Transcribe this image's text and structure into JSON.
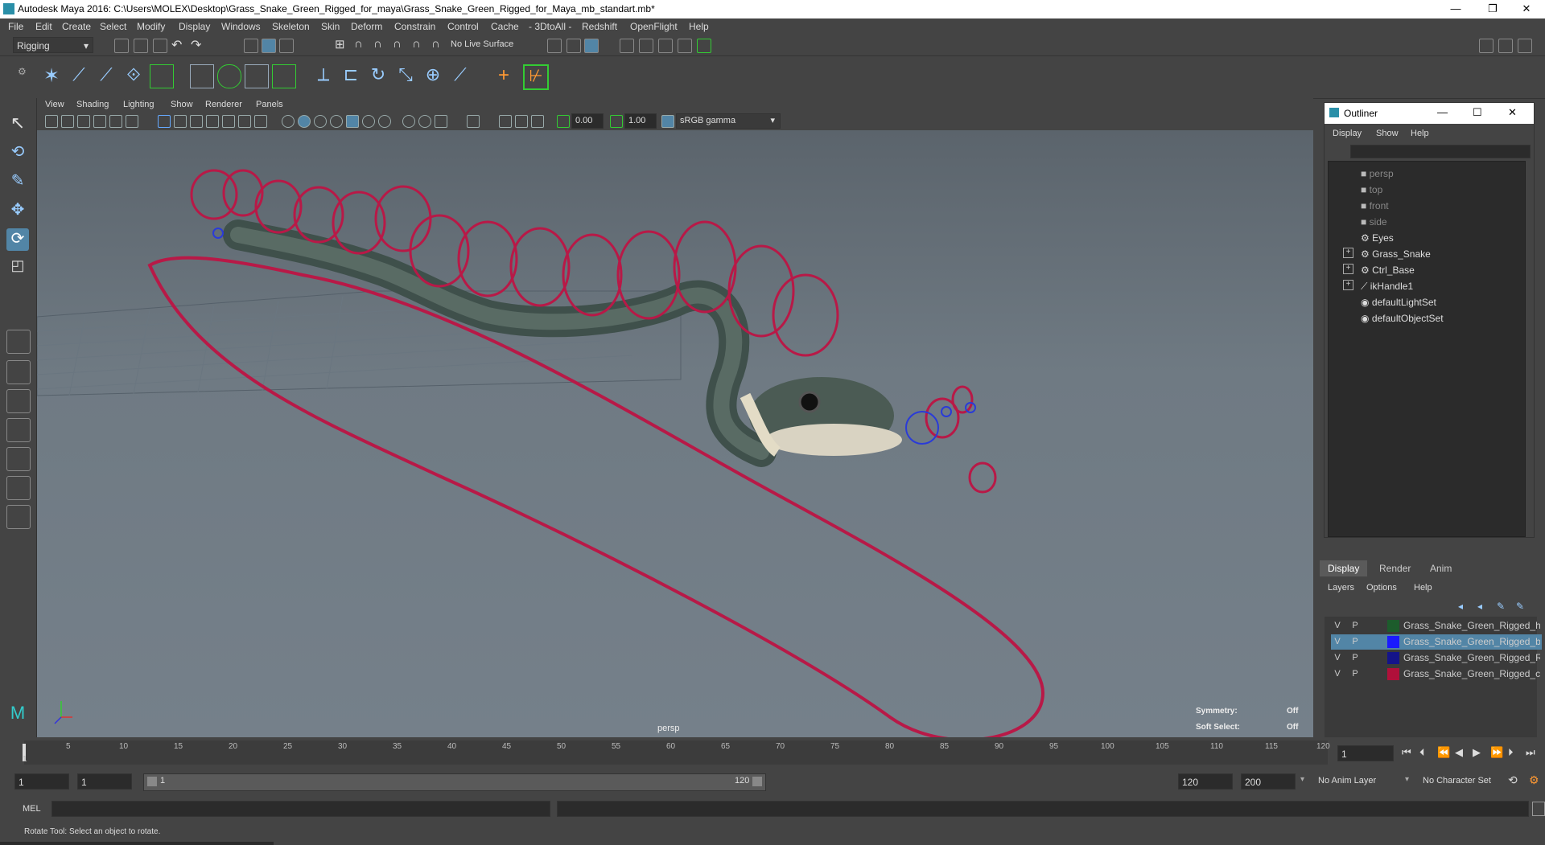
{
  "app": {
    "title": "Autodesk Maya 2016: C:\\Users\\MOLEX\\Desktop\\Grass_Snake_Green_Rigged_for_maya\\Grass_Snake_Green_Rigged_for_Maya_mb_standart.mb*",
    "window_controls": [
      "—",
      "❐",
      "✕"
    ]
  },
  "menubar": [
    "File",
    "Edit",
    "Create",
    "Select",
    "Modify",
    "Display",
    "Windows",
    "Skeleton",
    "Skin",
    "Deform",
    "Constrain",
    "Control",
    "Cache",
    "- 3DtoAll -",
    "Redshift",
    "OpenFlight",
    "Help"
  ],
  "statusline": {
    "menuset": "Rigging",
    "live_surface": "No Live Surface"
  },
  "viewport": {
    "menus": [
      "View",
      "Shading",
      "Lighting",
      "Show",
      "Renderer",
      "Panels"
    ],
    "near_value": "0.00",
    "far_value": "1.00",
    "colorspace": "sRGB gamma",
    "camera_label": "persp",
    "hud": {
      "symmetry_label": "Symmetry:",
      "symmetry_value": "Off",
      "soft_select_label": "Soft Select:",
      "soft_select_value": "Off"
    }
  },
  "outliner": {
    "title": "Outliner",
    "menus": [
      "Display",
      "Show",
      "Help"
    ],
    "items": [
      {
        "label": "persp",
        "dim": true,
        "expand": false
      },
      {
        "label": "top",
        "dim": true,
        "expand": false
      },
      {
        "label": "front",
        "dim": true,
        "expand": false
      },
      {
        "label": "side",
        "dim": true,
        "expand": false
      },
      {
        "label": "Eyes",
        "dim": false,
        "expand": false
      },
      {
        "label": "Grass_Snake",
        "dim": false,
        "expand": true
      },
      {
        "label": "Ctrl_Base",
        "dim": false,
        "expand": true
      },
      {
        "label": "ikHandle1",
        "dim": false,
        "expand": true
      },
      {
        "label": "defaultLightSet",
        "dim": false,
        "expand": false
      },
      {
        "label": "defaultObjectSet",
        "dim": false,
        "expand": false
      }
    ]
  },
  "layer_editor": {
    "tabs": [
      "Display",
      "Render",
      "Anim"
    ],
    "menus": [
      "Layers",
      "Options",
      "Help"
    ],
    "layers": [
      {
        "v": "V",
        "p": "P",
        "color": "#1d5c2c",
        "name": "Grass_Snake_Green_Rigged_help",
        "selected": false
      },
      {
        "v": "V",
        "p": "P",
        "color": "#1a1aff",
        "name": "Grass_Snake_Green_Rigged_bon",
        "selected": true
      },
      {
        "v": "V",
        "p": "P",
        "color": "#14148a",
        "name": "Grass_Snake_Green_Rigged_Rig",
        "selected": false
      },
      {
        "v": "V",
        "p": "P",
        "color": "#b0103a",
        "name": "Grass_Snake_Green_Rigged_con",
        "selected": false
      }
    ]
  },
  "timeline": {
    "ticks": [
      "1",
      "5",
      "10",
      "15",
      "20",
      "25",
      "30",
      "35",
      "40",
      "45",
      "50",
      "55",
      "60",
      "65",
      "70",
      "75",
      "80",
      "85",
      "90",
      "95",
      "100",
      "105",
      "110",
      "115",
      "120"
    ],
    "current_frame": "1"
  },
  "range": {
    "start": "1",
    "playback_start": "1",
    "slider_start": "1",
    "slider_end": "120",
    "playback_end": "120",
    "end": "200",
    "anim_layer": "No Anim Layer",
    "character_set": "No Character Set"
  },
  "command": {
    "mel_label": "MEL"
  },
  "helpline": "Rotate Tool: Select an object to rotate."
}
